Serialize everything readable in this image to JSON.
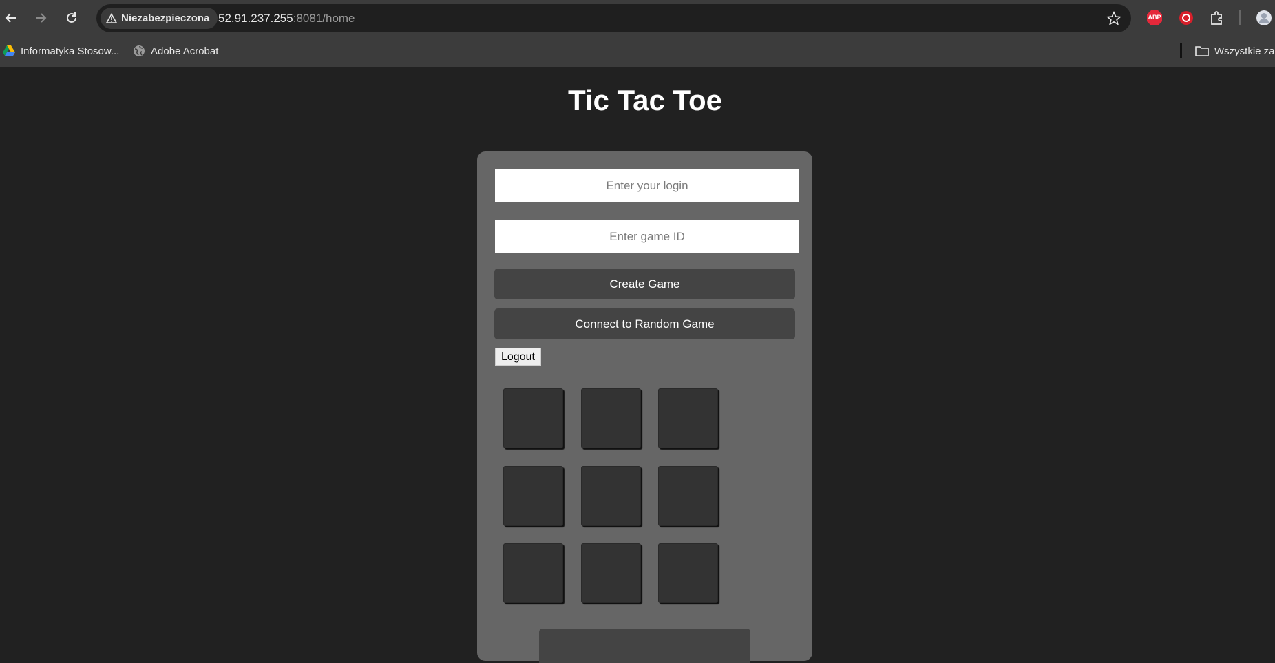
{
  "browser": {
    "security_label": "Niezabezpieczona",
    "url_host": "52.91.237.255",
    "url_rest": ":8081/home",
    "bookmarks": [
      {
        "label": "Informatyka Stosow...",
        "icon": "google-drive-icon"
      },
      {
        "label": "Adobe Acrobat",
        "icon": "globe-icon"
      }
    ],
    "all_bookmarks_label": "Wszystkie za",
    "extensions": [
      "adblock-plus-icon",
      "red-extension-icon",
      "puzzle-icon",
      "profile-avatar"
    ],
    "abp_text": "ABP"
  },
  "page": {
    "title": "Tic Tac Toe",
    "login_placeholder": "Enter your login",
    "game_id_placeholder": "Enter game ID",
    "create_game_label": "Create Game",
    "connect_random_label": "Connect to Random Game",
    "logout_label": "Logout",
    "board": [
      "",
      "",
      "",
      "",
      "",
      "",
      "",
      "",
      ""
    ]
  },
  "colors": {
    "page_bg": "#212121",
    "card_bg": "#666666",
    "button_bg": "#444444",
    "cell_bg": "#333333"
  }
}
